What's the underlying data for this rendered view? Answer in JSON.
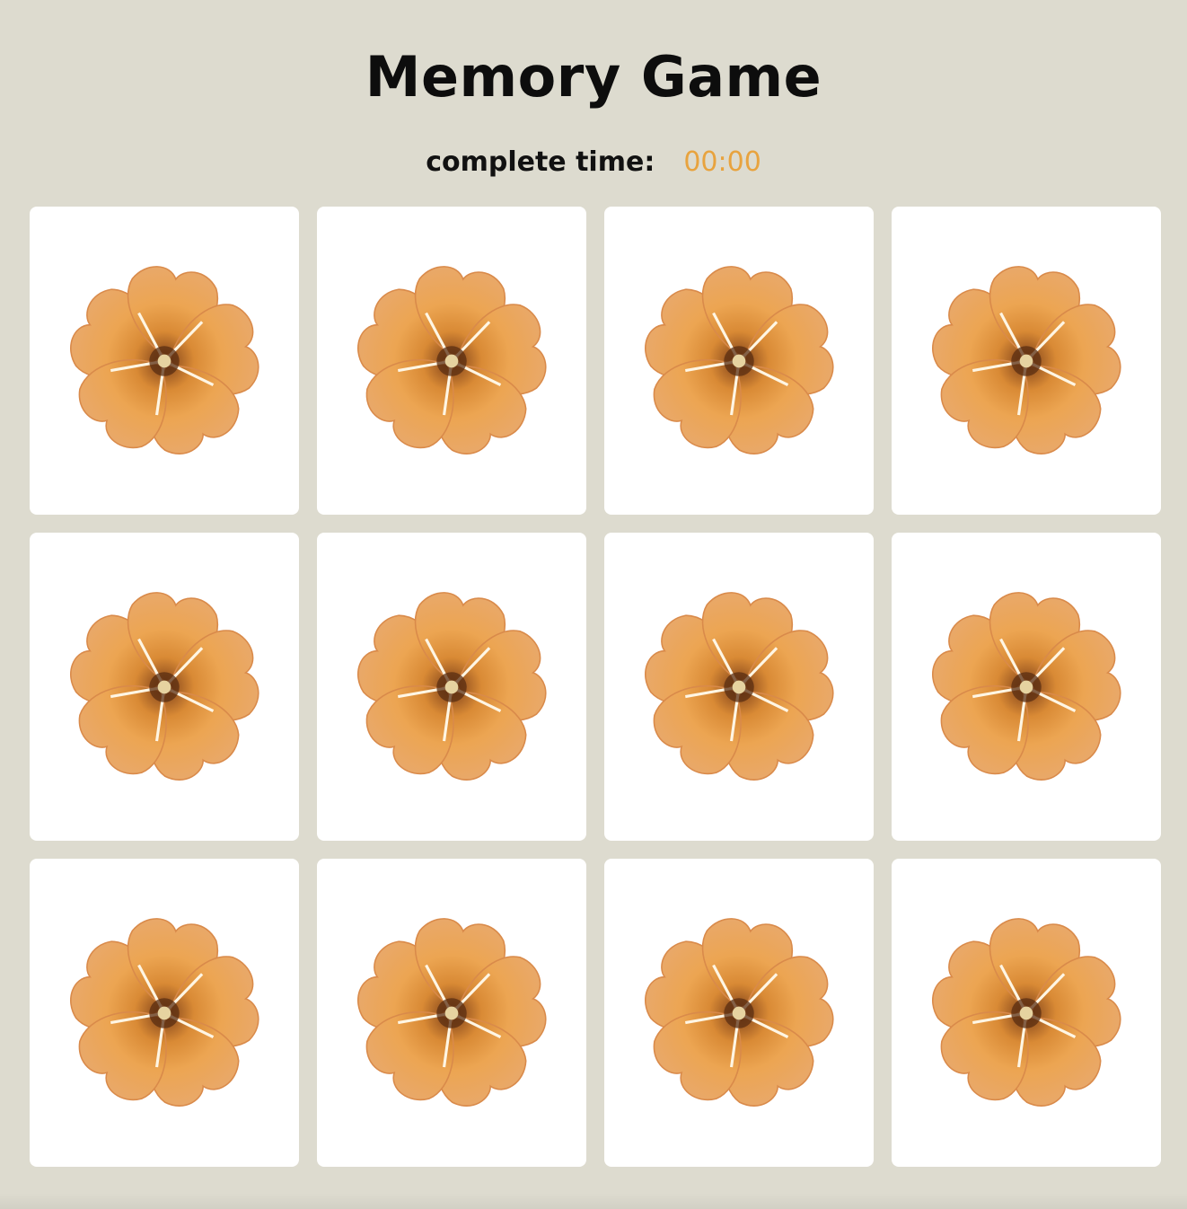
{
  "header": {
    "title": "Memory Game"
  },
  "timer": {
    "label": "complete time:",
    "value": "00:00"
  },
  "board": {
    "columns": 4,
    "rows": 3,
    "cards": [
      {
        "state": "face-down",
        "icon": "flower-icon"
      },
      {
        "state": "face-down",
        "icon": "flower-icon"
      },
      {
        "state": "face-down",
        "icon": "flower-icon"
      },
      {
        "state": "face-down",
        "icon": "flower-icon"
      },
      {
        "state": "face-down",
        "icon": "flower-icon"
      },
      {
        "state": "face-down",
        "icon": "flower-icon"
      },
      {
        "state": "face-down",
        "icon": "flower-icon"
      },
      {
        "state": "face-down",
        "icon": "flower-icon"
      },
      {
        "state": "face-down",
        "icon": "flower-icon"
      },
      {
        "state": "face-down",
        "icon": "flower-icon"
      },
      {
        "state": "face-down",
        "icon": "flower-icon"
      },
      {
        "state": "face-down",
        "icon": "flower-icon"
      }
    ]
  },
  "colors": {
    "background": "#dddbcf",
    "card": "#ffffff",
    "timer_value": "#e8a33e",
    "petal": "#eca552",
    "petal_edge": "#d98a4a",
    "flower_center": "#5a2e12"
  }
}
